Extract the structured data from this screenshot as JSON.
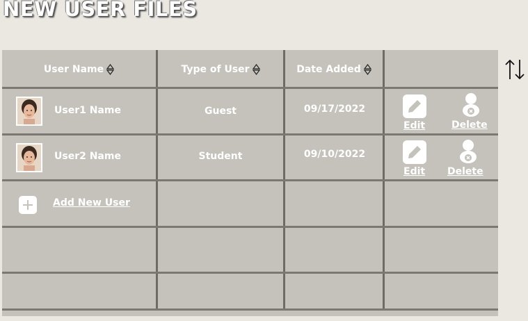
{
  "title": "NEW USER FILES",
  "headers": {
    "user_name": "User Name",
    "type_of_user": "Type of User",
    "date_added": "Date Added",
    "actions": ""
  },
  "rows": [
    {
      "name": "User1 Name",
      "type": "Guest",
      "date": "09/17/2022",
      "edit": "Edit",
      "delete": "Delete"
    },
    {
      "name": "User2 Name",
      "type": "Student",
      "date": "09/10/2022",
      "edit": "Edit",
      "delete": "Delete"
    }
  ],
  "add_user_label": "Add New User",
  "icons": {
    "sort_column": "sort-arrows-icon",
    "sort_table": "up-down-arrows-icon",
    "edit": "pencil-icon",
    "delete": "remove-user-icon",
    "add": "plus-icon",
    "avatar": "user-photo"
  },
  "colors": {
    "background": "#ebe8e2",
    "table": "#c4c2bb",
    "gridline": "#6d6b64",
    "text": "#ffffff"
  }
}
